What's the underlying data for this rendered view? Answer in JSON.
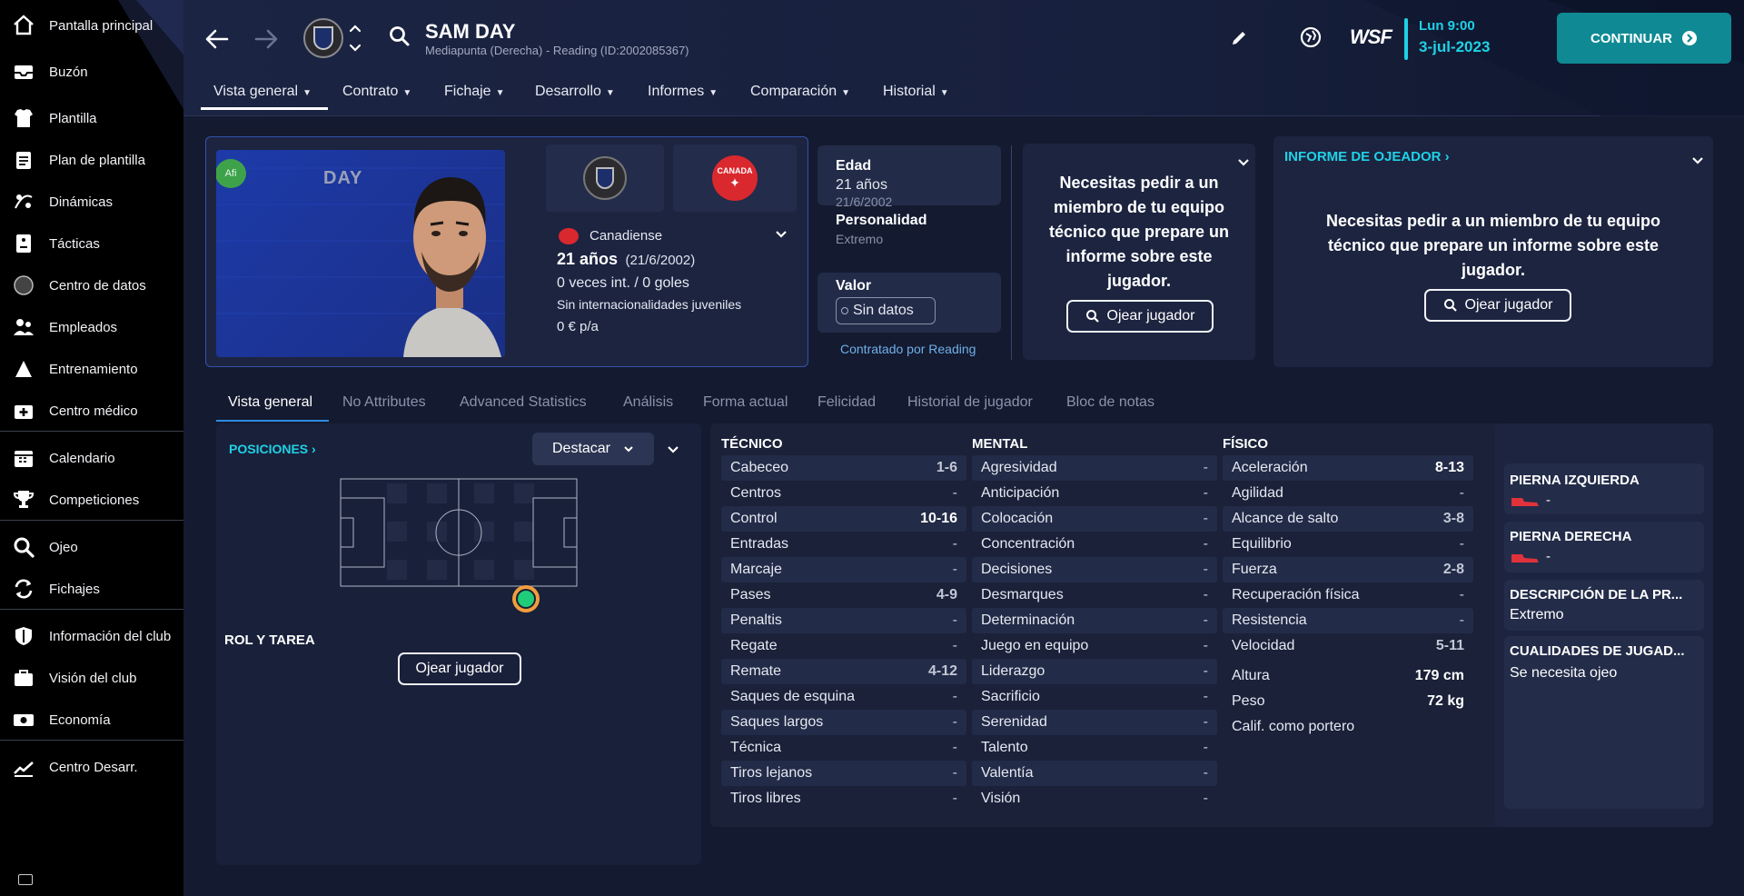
{
  "sidebar": {
    "items": [
      {
        "label": "Pantalla principal",
        "icon": "home-icon"
      },
      {
        "label": "Buzón",
        "icon": "inbox-icon"
      },
      {
        "label": "Plantilla",
        "icon": "shirt-icon"
      },
      {
        "label": "Plan de plantilla",
        "icon": "clipboard-icon"
      },
      {
        "label": "Dinámicas",
        "icon": "dynamics-icon"
      },
      {
        "label": "Tácticas",
        "icon": "tactics-icon"
      },
      {
        "label": "Centro de datos",
        "icon": "data-icon"
      },
      {
        "label": "Empleados",
        "icon": "staff-icon"
      },
      {
        "label": "Entrenamiento",
        "icon": "training-icon"
      },
      {
        "label": "Centro médico",
        "icon": "medical-icon"
      },
      {
        "label": "Calendario",
        "icon": "calendar-icon"
      },
      {
        "label": "Competiciones",
        "icon": "trophy-icon"
      },
      {
        "label": "Ojeo",
        "icon": "scouting-icon"
      },
      {
        "label": "Fichajes",
        "icon": "transfers-icon"
      },
      {
        "label": "Información del club",
        "icon": "shield-icon"
      },
      {
        "label": "Visión del club",
        "icon": "briefcase-icon"
      },
      {
        "label": "Economía",
        "icon": "money-icon"
      },
      {
        "label": "Centro Desarr.",
        "icon": "chart-icon"
      }
    ]
  },
  "header": {
    "player_name": "SAM DAY",
    "player_sub": "Mediapunta (Derecha) - Reading (ID:2002085367)",
    "day_time": "Lun 9:00",
    "date": "3-jul-2023",
    "continue_label": "CONTINUAR",
    "tabs": [
      "Vista general",
      "Contrato",
      "Fichaje",
      "Desarrollo",
      "Informes",
      "Comparación",
      "Historial"
    ]
  },
  "profile": {
    "badge": "Afi",
    "card_name": "DAY",
    "nationality": "Canadiense",
    "nation_flag_text": "CANADA",
    "age_main": "21 años",
    "age_dob": "(21/6/2002)",
    "caps": "0 veces int. / 0 goles",
    "youth_caps": "Sin internacionalidades juveniles",
    "wage": "0 € p/a"
  },
  "details": {
    "age_label": "Edad",
    "age_value": "21 años",
    "dob": "21/6/2002",
    "personality_label": "Personalidad",
    "personality_value": "Extremo",
    "value_label": "Valor",
    "value_value": "Sin datos",
    "contracted_by": "Contratado por Reading"
  },
  "staff_request": {
    "text": "Necesitas pedir a un miembro de tu equipo técnico que prepare un informe sobre este jugador.",
    "button": "Ojear jugador"
  },
  "scout_report": {
    "title": "INFORME DE OJEADOR",
    "text": "Necesitas pedir a un miembro de tu equipo técnico que prepare un informe sobre este jugador.",
    "button": "Ojear jugador"
  },
  "subtabs": [
    "Vista general",
    "No Attributes",
    "Advanced Statistics",
    "Análisis",
    "Forma actual",
    "Felicidad",
    "Historial de jugador",
    "Bloc de notas"
  ],
  "positions": {
    "title": "POSICIONES",
    "dropdown": "Destacar",
    "role_title": "ROL Y TAREA",
    "button": "Ojear jugador"
  },
  "attributes": {
    "technical_title": "TÉCNICO",
    "mental_title": "MENTAL",
    "physical_title": "FÍSICO",
    "technical": [
      {
        "name": "Cabeceo",
        "value": "1-6"
      },
      {
        "name": "Centros",
        "value": "-"
      },
      {
        "name": "Control",
        "value": "10-16"
      },
      {
        "name": "Entradas",
        "value": "-"
      },
      {
        "name": "Marcaje",
        "value": "-"
      },
      {
        "name": "Pases",
        "value": "4-9"
      },
      {
        "name": "Penaltis",
        "value": "-"
      },
      {
        "name": "Regate",
        "value": "-"
      },
      {
        "name": "Remate",
        "value": "4-12"
      },
      {
        "name": "Saques de esquina",
        "value": "-"
      },
      {
        "name": "Saques largos",
        "value": "-"
      },
      {
        "name": "Técnica",
        "value": "-"
      },
      {
        "name": "Tiros lejanos",
        "value": "-"
      },
      {
        "name": "Tiros libres",
        "value": "-"
      }
    ],
    "mental": [
      {
        "name": "Agresividad",
        "value": "-"
      },
      {
        "name": "Anticipación",
        "value": "-"
      },
      {
        "name": "Colocación",
        "value": "-"
      },
      {
        "name": "Concentración",
        "value": "-"
      },
      {
        "name": "Decisiones",
        "value": "-"
      },
      {
        "name": "Desmarques",
        "value": "-"
      },
      {
        "name": "Determinación",
        "value": "-"
      },
      {
        "name": "Juego en equipo",
        "value": "-"
      },
      {
        "name": "Liderazgo",
        "value": "-"
      },
      {
        "name": "Sacrificio",
        "value": "-"
      },
      {
        "name": "Serenidad",
        "value": "-"
      },
      {
        "name": "Talento",
        "value": "-"
      },
      {
        "name": "Valentía",
        "value": "-"
      },
      {
        "name": "Visión",
        "value": "-"
      }
    ],
    "physical": [
      {
        "name": "Aceleración",
        "value": "8-13"
      },
      {
        "name": "Agilidad",
        "value": "-"
      },
      {
        "name": "Alcance de salto",
        "value": "3-8"
      },
      {
        "name": "Equilibrio",
        "value": "-"
      },
      {
        "name": "Fuerza",
        "value": "2-8"
      },
      {
        "name": "Recuperación física",
        "value": "-"
      },
      {
        "name": "Resistencia",
        "value": "-"
      },
      {
        "name": "Velocidad",
        "value": "5-11"
      }
    ],
    "extra": [
      {
        "name": "Altura",
        "value": "179 cm"
      },
      {
        "name": "Peso",
        "value": "72 kg"
      },
      {
        "name": "Calif. como portero",
        "value": ""
      }
    ]
  },
  "side_info": {
    "left_foot_label": "PIERNA IZQUIERDA",
    "left_foot_value": "-",
    "right_foot_label": "PIERNA DERECHA",
    "right_foot_value": "-",
    "description_label": "DESCRIPCIÓN DE LA PR...",
    "description_value": "Extremo",
    "qualities_label": "CUALIDADES DE JUGAD...",
    "qualities_value": "Se necesita ojeo"
  },
  "colors": {
    "accent_cyan": "#1fd1e6",
    "continue_bg": "#0f8a94",
    "position_green": "#1fcc7a",
    "position_ring": "#f29d3c"
  }
}
